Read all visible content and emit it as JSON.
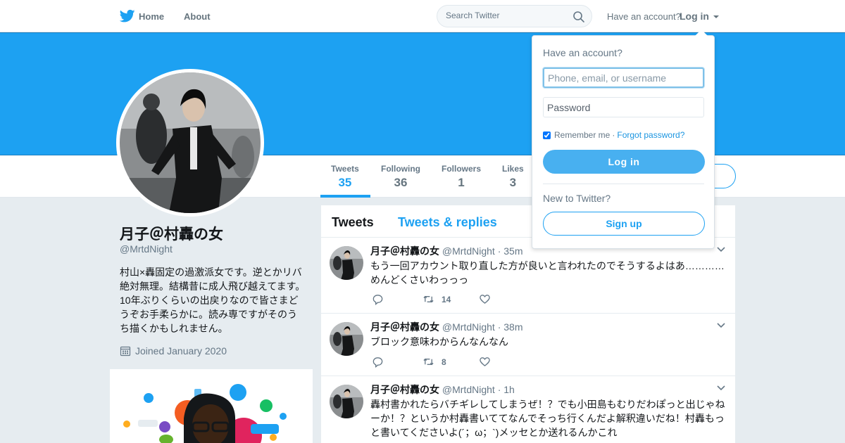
{
  "nav": {
    "home_label": "Home",
    "about_label": "About",
    "search_placeholder": "Search Twitter",
    "have_account": "Have an account?",
    "login_label": "Log in"
  },
  "colors": {
    "brand": "#1da1f2",
    "text_primary": "#14171a",
    "text_secondary": "#657786"
  },
  "icons": {
    "logo": "twitter-bird-icon",
    "search": "search-icon",
    "calendar": "calendar-icon",
    "reply": "reply-icon",
    "retweet": "retweet-icon",
    "like": "heart-icon",
    "more": "chevron-down-icon"
  },
  "stats": [
    {
      "label": "Tweets",
      "value": "35",
      "active": true
    },
    {
      "label": "Following",
      "value": "36"
    },
    {
      "label": "Followers",
      "value": "1"
    },
    {
      "label": "Likes",
      "value": "3"
    }
  ],
  "profile": {
    "name": "月子＠村轟の女",
    "handle": "@MrtdNight",
    "bio": "村山×轟固定の過激派女です。逆とかリバ絶対無理。結構昔に成人飛び越えてます。10年ぶりくらいの出戻りなので皆さまどうぞお手柔らかに。読み専ですがそのうち描くかもしれません。",
    "joined": "Joined January 2020"
  },
  "timeline": {
    "tabs": [
      {
        "label": "Tweets",
        "active": true
      },
      {
        "label": "Tweets & replies"
      }
    ],
    "tweets": [
      {
        "name": "月子＠村轟の女",
        "handle": "@MrtdNight",
        "dot": "·",
        "time": "35m",
        "text": "もう一回アカウント取り直した方が良いと言われたのでそうするよはあ…………めんどくさいわっっっ",
        "retweets": "14"
      },
      {
        "name": "月子＠村轟の女",
        "handle": "@MrtdNight",
        "dot": "·",
        "time": "38m",
        "text": "ブロック意味わからんなんなん",
        "retweets": "8"
      },
      {
        "name": "月子＠村轟の女",
        "handle": "@MrtdNight",
        "dot": "·",
        "time": "1h",
        "text": "轟村書かれたらバチギレしてしまうぜ！？でも小田島もむりだわぽっと出じゃねーか！？というか村轟書いててなんでそっち行くんだよ解釈違いだね！村轟もっと書いてくださいよ(´；ω；`)メッセとか送れるんかこれ",
        "retweets": ""
      }
    ]
  },
  "login_dropdown": {
    "title": "Have an account?",
    "username_placeholder": "Phone, email, or username",
    "password_placeholder": "Password",
    "remember_label": "Remember me",
    "separator": "·",
    "forgot_label": "Forgot password?",
    "login_button": "Log in",
    "new_label": "New to Twitter?",
    "signup_button": "Sign up"
  }
}
